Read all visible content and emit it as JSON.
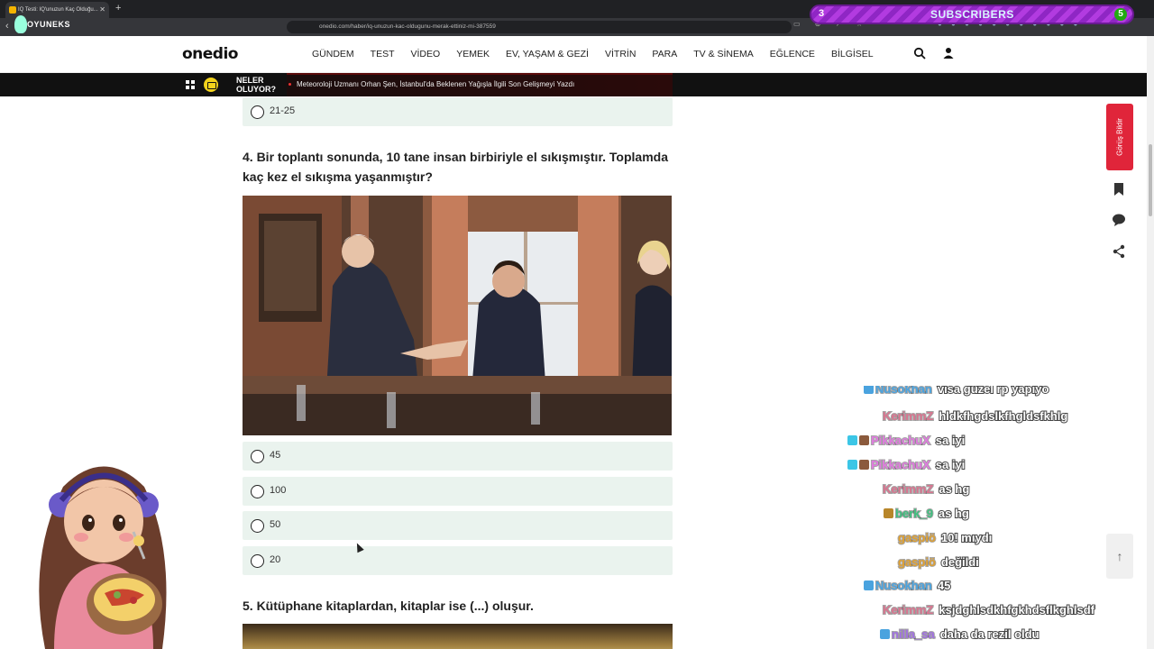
{
  "browser": {
    "tab_title": "IQ Testi: IQ'unuzun Kaç Olduğu...",
    "new_tab": "+",
    "url": "onedio.com/haber/iq-unuzun-kac-oldugunu-merak-ettiniz-mi-387559"
  },
  "overlay": {
    "logo_text": "OYUNEKS",
    "subs_left": "3",
    "subs_label": "SUBSCRIBERS",
    "subs_right": "5"
  },
  "site": {
    "logo": "onedio",
    "nav": [
      "GÜNDEM",
      "TEST",
      "VİDEO",
      "YEMEK",
      "EV, YAŞAM & GEZİ",
      "VİTRİN",
      "PARA",
      "TV & SİNEMA",
      "EĞLENCE",
      "BİLGİSEL"
    ],
    "ticker_title": "NELER OLUYOR?",
    "ticker_text": "Meteoroloji Uzmanı Orhan Şen, İstanbul'da Beklenen Yağışla İlgili Son Gelişmeyi Yazdı"
  },
  "quiz": {
    "prev_option": "21-25",
    "q4": "4. Bir toplantı sonunda, 10 tane insan birbiriyle el sıkışmıştır. Toplamda kaç kez el sıkışma yaşanmıştır?",
    "q4_options": [
      "45",
      "100",
      "50",
      "20"
    ],
    "q5": "5. Kütüphane kitaplardan, kitaplar ise (...) oluşur."
  },
  "side": {
    "feedback": "Görüş Bildir",
    "up": "↑"
  },
  "chat": [
    {
      "user": "Nusokhan",
      "msg": "visa güzel rp yapıyo",
      "color": "#4aa3df"
    },
    {
      "user": "KerimmZ",
      "msg": "hldkfhgdslkfhgldsfkhlg",
      "color": "#d9748f"
    },
    {
      "user": "PikkachuX",
      "msg": "sa iyi",
      "color": "#e07adf"
    },
    {
      "user": "PikkachuX",
      "msg": "sa iyi",
      "color": "#e07adf"
    },
    {
      "user": "KerimmZ",
      "msg": "as hg",
      "color": "#d9748f"
    },
    {
      "user": "berk_9",
      "msg": "as hg",
      "color": "#3fbf7f"
    },
    {
      "user": "gaspiö",
      "msg": "10! mıydı",
      "color": "#e0a030"
    },
    {
      "user": "gaspiö",
      "msg": "değildi",
      "color": "#e0a030"
    },
    {
      "user": "Nusokhan",
      "msg": "45",
      "color": "#4aa3df"
    },
    {
      "user": "KerimmZ",
      "msg": "ksjdghlsdkhfgkhdsflkghlsdf",
      "color": "#d9748f"
    },
    {
      "user": "nilla_sa",
      "msg": "daha da rezil oldu",
      "color": "#a070e0"
    }
  ]
}
